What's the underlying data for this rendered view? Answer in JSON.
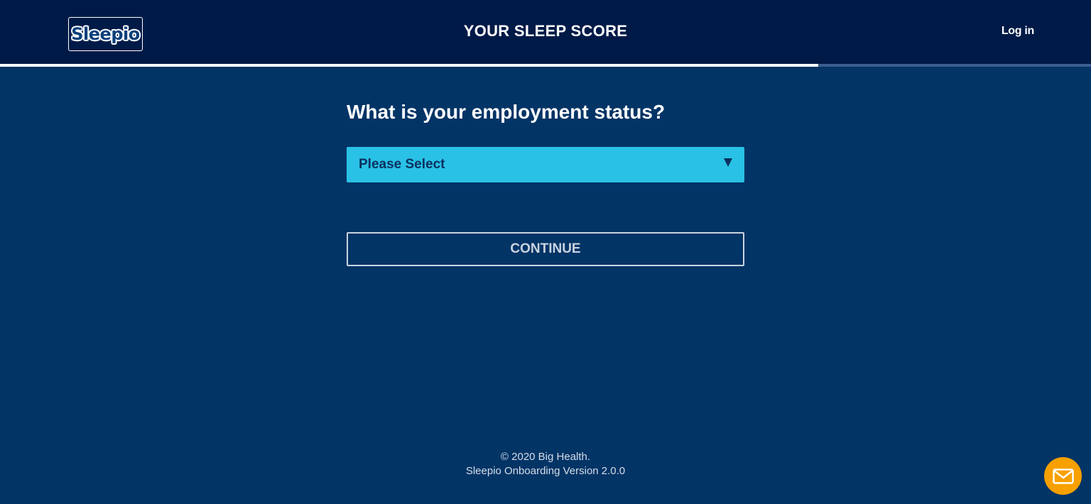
{
  "header": {
    "logo_text": "Sleepio",
    "title": "YOUR SLEEP SCORE",
    "login_label": "Log in"
  },
  "progress": {
    "fraction": 0.75,
    "fill_color": "#ffffff",
    "track_color": "#3a5f8f"
  },
  "main": {
    "question": "What is your employment status?",
    "select": {
      "selected_value": "Please Select",
      "icon": "chevron-down-icon"
    },
    "continue_label": "CONTINUE"
  },
  "footer": {
    "copyright": "© 2020 Big Health.",
    "version": "Sleepio Onboarding Version 2.0.0"
  },
  "chat": {
    "icon": "mail-icon",
    "color": "#f7a000"
  },
  "colors": {
    "header_bg": "#001a47",
    "page_bg": "#033466",
    "select_bg": "#29c1e5"
  }
}
